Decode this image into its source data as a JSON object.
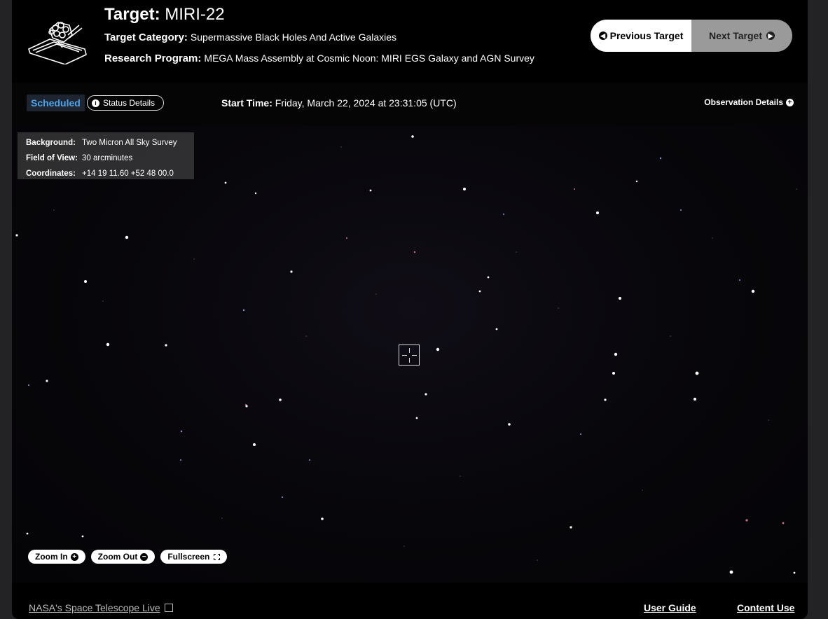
{
  "header": {
    "target_label": "Target:",
    "target_value": "MIRI-22",
    "category_label": "Target Category:",
    "category_value": "Supermassive Black Holes And Active Galaxies",
    "program_label": "Research Program:",
    "program_value": "MEGA Mass Assembly at Cosmic Noon: MIRI EGS Galaxy and AGN Survey",
    "prev_label": "Previous Target",
    "next_label": "Next Target",
    "logo_icon": "telescope-logo-icon"
  },
  "status": {
    "badge": "Scheduled",
    "badge_color": "#4da3ea",
    "details_label": "Status Details",
    "start_label": "Start Time:",
    "start_value": "Friday, March 22, 2024 at 23:31:05 (UTC)",
    "obs_details_label": "Observation Details"
  },
  "viewer": {
    "info": [
      {
        "key": "Background:",
        "value": "Two Micron All Sky Survey"
      },
      {
        "key": "Field of View:",
        "value": "30 arcminutes"
      },
      {
        "key": "Coordinates:",
        "value": "+14 19 11.60 +52 48 00.0"
      }
    ],
    "zoom_in_label": "Zoom In",
    "zoom_out_label": "Zoom Out",
    "fullscreen_label": "Fullscreen"
  },
  "footer": {
    "site_link": "NASA's Space Telescope Live",
    "user_guide": "User Guide",
    "content_use": "Content Use"
  }
}
